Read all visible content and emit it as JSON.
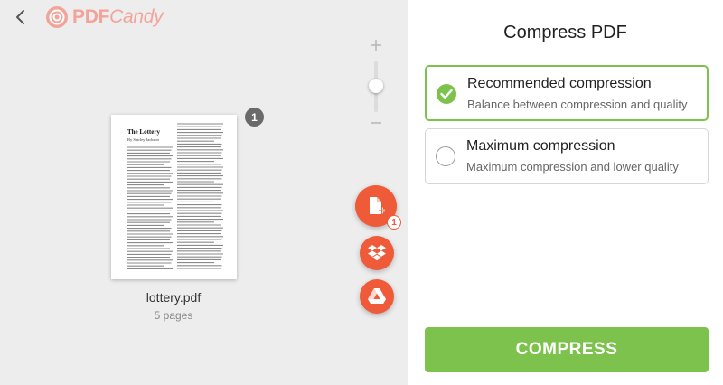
{
  "header": {
    "logo_text_pdf": "PDF",
    "logo_text_candy": "Candy",
    "back_icon": "chevron-left-icon"
  },
  "zoom": {
    "plus_icon": "plus-icon",
    "minus_icon": "minus-icon",
    "level": 0.55
  },
  "file": {
    "name": "lottery.pdf",
    "pages": "5 pages",
    "badge": "1",
    "preview_title": "The Lottery",
    "preview_author": "By Shirley Jackson"
  },
  "actions": {
    "add_badge": "1",
    "add_icon": "file-add-icon",
    "dropbox_icon": "dropbox-icon",
    "drive_icon": "google-drive-icon"
  },
  "panel": {
    "title": "Compress PDF",
    "options": [
      {
        "title": "Recommended compression",
        "desc": "Balance between compression and quality",
        "selected": true
      },
      {
        "title": "Maximum compression",
        "desc": "Maximum compression and lower quality",
        "selected": false
      }
    ],
    "button": "COMPRESS"
  },
  "colors": {
    "accent_green": "#7cc24d",
    "accent_orange": "#ef5a39",
    "logo_pink": "#f2a49a",
    "left_bg": "#ededed"
  }
}
